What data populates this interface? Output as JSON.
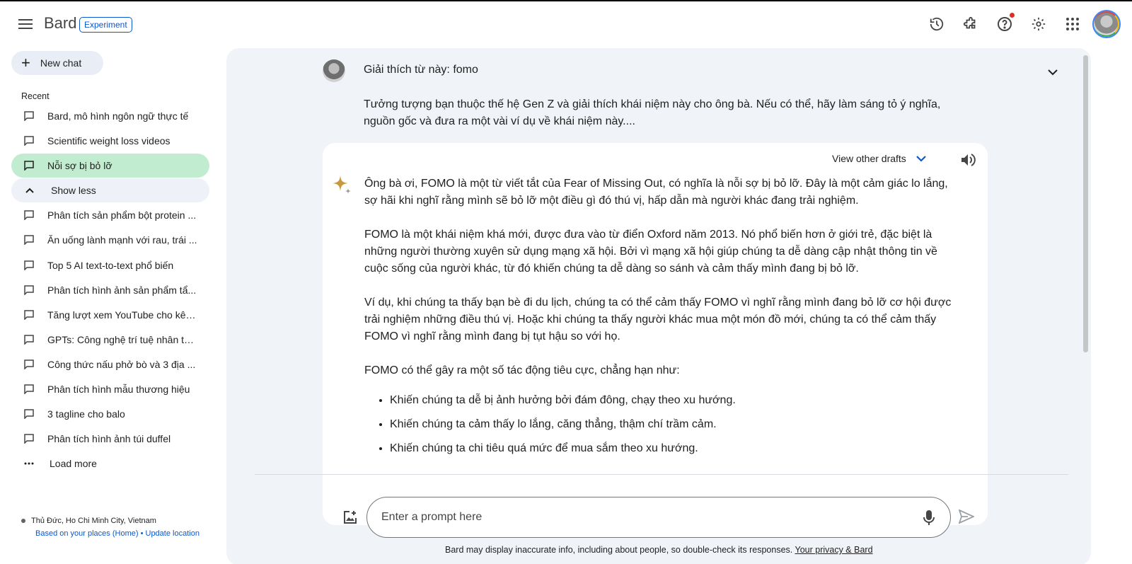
{
  "header": {
    "brand": "Bard",
    "badge": "Experiment",
    "icons": [
      "history-icon",
      "extensions-icon",
      "help-icon",
      "settings-icon",
      "apps-icon"
    ]
  },
  "sidebar": {
    "new_chat": "New chat",
    "recent_label": "Recent",
    "items": [
      {
        "label": "Bard, mô hình ngôn ngữ thực tế"
      },
      {
        "label": "Scientific weight loss videos"
      },
      {
        "label": "Nỗi sợ bị bỏ lỡ"
      },
      {
        "label": "Show less"
      },
      {
        "label": "Phân tích sản phẩm bột protein ..."
      },
      {
        "label": "Ăn uống lành mạnh với rau, trái ..."
      },
      {
        "label": "Top 5 AI text-to-text phổ biến"
      },
      {
        "label": "Phân tích hình ảnh sản phẩm tẩ..."
      },
      {
        "label": "Tăng lượt xem YouTube cho kên..."
      },
      {
        "label": "GPTs: Công nghệ trí tuệ nhân tạ..."
      },
      {
        "label": "Công thức nấu phở bò và 3 địa ..."
      },
      {
        "label": "Phân tích hình mẫu thương hiệu"
      },
      {
        "label": "3 tagline cho balo"
      },
      {
        "label": "Phân tích hình ảnh túi duffel"
      },
      {
        "label": "Load more"
      }
    ],
    "location": {
      "city": "Thủ Đức, Ho Chi Minh City, Vietnam",
      "source": "Based on your places (Home)",
      "separator": "•",
      "update": "Update location"
    }
  },
  "conversation": {
    "prompt_title": "Giải thích từ này: fomo",
    "prompt_body": "Tưởng tượng bạn thuộc thế hệ Gen Z và giải thích khái niệm này cho ông bà. Nếu có thể, hãy làm sáng tỏ ý nghĩa, nguồn gốc và đưa ra một vài ví dụ về khái niệm này....",
    "view_drafts": "View other drafts",
    "answer_paragraphs": [
      "Ông bà ơi, FOMO là một từ viết tắt của Fear of Missing Out, có nghĩa là nỗi sợ bị bỏ lỡ. Đây là một cảm giác lo lắng, sợ hãi khi nghĩ rằng mình sẽ bỏ lỡ một điều gì đó thú vị, hấp dẫn mà người khác đang trải nghiệm.",
      "FOMO là một khái niệm khá mới, được đưa vào từ điển Oxford năm 2013. Nó phổ biến hơn ở giới trẻ, đặc biệt là những người thường xuyên sử dụng mạng xã hội. Bởi vì mạng xã hội giúp chúng ta dễ dàng cập nhật thông tin về cuộc sống của người khác, từ đó khiến chúng ta dễ dàng so sánh và cảm thấy mình đang bị bỏ lỡ.",
      "Ví dụ, khi chúng ta thấy bạn bè đi du lịch, chúng ta có thể cảm thấy FOMO vì nghĩ rằng mình đang bỏ lỡ cơ hội được trải nghiệm những điều thú vị. Hoặc khi chúng ta thấy người khác mua một món đồ mới, chúng ta có thể cảm thấy FOMO vì nghĩ rằng mình đang bị tụt hậu so với họ.",
      "FOMO có thể gây ra một số tác động tiêu cực, chẳng hạn như:"
    ],
    "answer_bullets": [
      "Khiến chúng ta dễ bị ảnh hưởng bởi đám đông, chạy theo xu hướng.",
      "Khiến chúng ta cảm thấy lo lắng, căng thẳng, thậm chí trầm cảm.",
      "Khiến chúng ta chi tiêu quá mức để mua sắm theo xu hướng."
    ]
  },
  "input": {
    "placeholder": "Enter a prompt here",
    "value": ""
  },
  "footer": {
    "disclaimer": "Bard may display inaccurate info, including about people, so double-check its responses.",
    "privacy_link": "Your privacy & Bard"
  },
  "colors": {
    "accent": "#0b57d0",
    "active_item": "#c2ecd0",
    "main_bg": "#f0f4f9",
    "notification": "#d93025"
  }
}
